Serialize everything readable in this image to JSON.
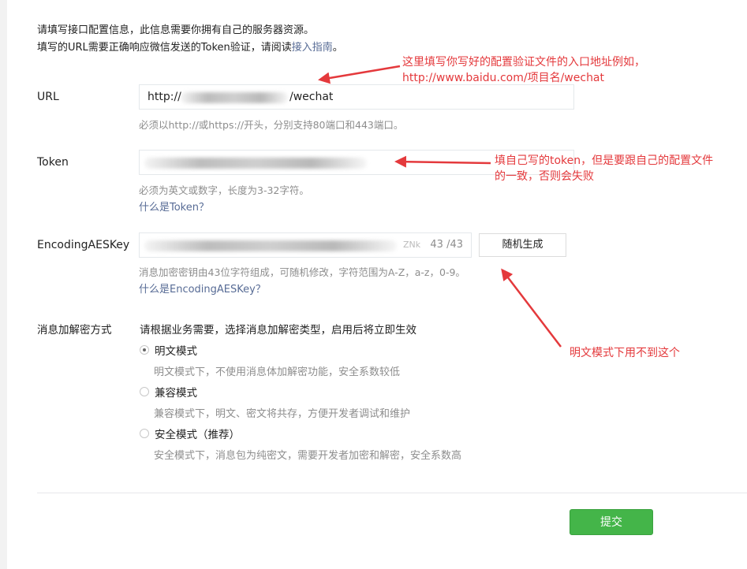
{
  "intro": {
    "line1": "请填写接口配置信息，此信息需要你拥有自己的服务器资源。",
    "line2_prefix": "填写的URL需要正确响应微信发送的Token验证，请阅读",
    "line2_link": "接入指南",
    "line2_suffix": "。"
  },
  "url": {
    "label": "URL",
    "value_prefix": "http://",
    "value_suffix": "/wechat",
    "hint": "必须以http://或https://开头，分别支持80端口和443端口。"
  },
  "token": {
    "label": "Token",
    "hint": "必须为英文或数字，长度为3-32字符。",
    "help": "什么是Token？"
  },
  "aes": {
    "label": "EncodingAESKey",
    "visible_tail": "ZNk",
    "counter": "43 /43",
    "generate_button": "随机生成",
    "hint": "消息加密密钥由43位字符组成，可随机修改，字符范围为A-Z，a-z，0-9。",
    "help": "什么是EncodingAESKey？"
  },
  "encryption": {
    "label": "消息加解密方式",
    "instruction": "请根据业务需要，选择消息加解密类型，启用后将立即生效",
    "options": [
      {
        "label": "明文模式",
        "desc": "明文模式下，不使用消息体加解密功能，安全系数较低",
        "checked": true
      },
      {
        "label": "兼容模式",
        "desc": "兼容模式下，明文、密文将共存，方便开发者调试和维护",
        "checked": false
      },
      {
        "label": "安全模式（推荐）",
        "desc": "安全模式下，消息包为纯密文，需要开发者加密和解密，安全系数高",
        "checked": false
      }
    ]
  },
  "submit_label": "提交",
  "annotations": {
    "url_note_line1": "这里填写你写好的配置验证文件的入口地址例如，",
    "url_note_line2": "http://www.baidu.com/项目名/wechat",
    "token_note_line1": "填自己写的token，但是要跟自己的配置文件",
    "token_note_line2": "的一致，否则会失败",
    "aes_note": "明文模式下用不到这个"
  },
  "colors": {
    "link": "#576b95",
    "hint": "#8d8d8d",
    "primary_button": "#44b549",
    "annotation": "#e4393c"
  }
}
